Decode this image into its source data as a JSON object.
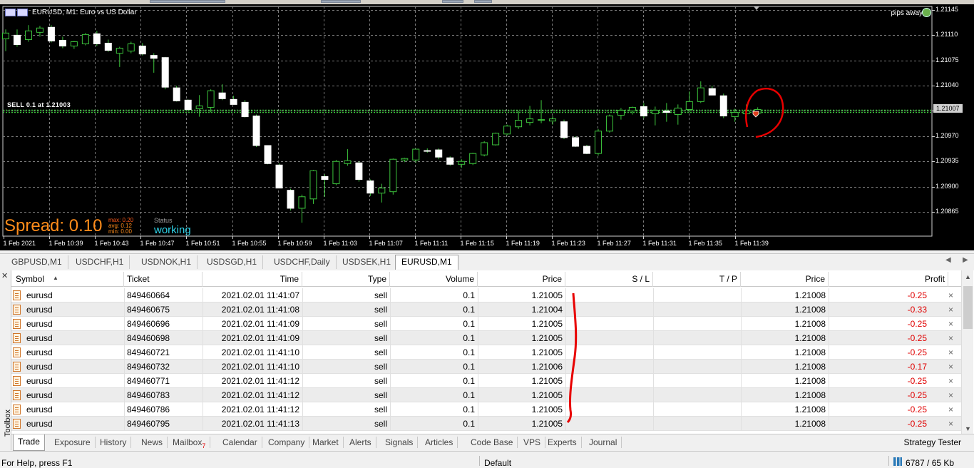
{
  "chart": {
    "title": "EURUSD, M1:  Euro vs US Dollar",
    "pips_away": "pips away",
    "sell_label": "SELL 0.1 at 1.21003",
    "current_price": "1.21007",
    "spread_label": "Spread: 0.10",
    "spread_max": "max: 0.20",
    "spread_avg": "avg: 0.12",
    "spread_min": "min: 0.00",
    "status_label": "Status",
    "status_value": "working",
    "y_axis": [
      "1.21145",
      "1.21110",
      "1.21075",
      "1.21040",
      "1.20970",
      "1.20935",
      "1.20900",
      "1.20865"
    ],
    "x_axis": [
      "1 Feb 2021",
      "1 Feb 10:39",
      "1 Feb 10:43",
      "1 Feb 10:47",
      "1 Feb 10:51",
      "1 Feb 10:55",
      "1 Feb 10:59",
      "1 Feb 11:03",
      "1 Feb 11:07",
      "1 Feb 11:11",
      "1 Feb 11:15",
      "1 Feb 11:19",
      "1 Feb 11:23",
      "1 Feb 11:27",
      "1 Feb 11:31",
      "1 Feb 11:35",
      "1 Feb 11:39"
    ],
    "colors": {
      "background": "#000000",
      "grid": "#7a7a7a",
      "bull": "#000000",
      "bull_wick": "#3cc43c",
      "bear": "#ffffff",
      "ask_line": "#3cc43c",
      "spread_text": "#ff8c1a",
      "status_text": "#2fd3e8"
    },
    "candles": [
      {
        "o": 1.21105,
        "h": 1.21118,
        "l": 1.21088,
        "c": 1.21113
      },
      {
        "o": 1.2111,
        "h": 1.21118,
        "l": 1.21094,
        "c": 1.21097
      },
      {
        "o": 1.21104,
        "h": 1.21124,
        "l": 1.21101,
        "c": 1.21116
      },
      {
        "o": 1.21114,
        "h": 1.21123,
        "l": 1.21108,
        "c": 1.2112
      },
      {
        "o": 1.21121,
        "h": 1.21124,
        "l": 1.211,
        "c": 1.21102
      },
      {
        "o": 1.21103,
        "h": 1.21108,
        "l": 1.21092,
        "c": 1.21095
      },
      {
        "o": 1.21095,
        "h": 1.21102,
        "l": 1.21091,
        "c": 1.21101
      },
      {
        "o": 1.21098,
        "h": 1.21113,
        "l": 1.21096,
        "c": 1.21111
      },
      {
        "o": 1.21112,
        "h": 1.21116,
        "l": 1.21095,
        "c": 1.21098
      },
      {
        "o": 1.21099,
        "h": 1.21104,
        "l": 1.21087,
        "c": 1.21089
      },
      {
        "o": 1.21085,
        "h": 1.21094,
        "l": 1.21066,
        "c": 1.21092
      },
      {
        "o": 1.21088,
        "h": 1.21101,
        "l": 1.21085,
        "c": 1.21098
      },
      {
        "o": 1.21095,
        "h": 1.21099,
        "l": 1.21082,
        "c": 1.21084
      },
      {
        "o": 1.21082,
        "h": 1.21085,
        "l": 1.21058,
        "c": 1.21078
      },
      {
        "o": 1.21079,
        "h": 1.2108,
        "l": 1.21035,
        "c": 1.21038
      },
      {
        "o": 1.21037,
        "h": 1.2104,
        "l": 1.21018,
        "c": 1.21019
      },
      {
        "o": 1.2102,
        "h": 1.21021,
        "l": 1.21006,
        "c": 1.21007
      },
      {
        "o": 1.21008,
        "h": 1.21027,
        "l": 1.20997,
        "c": 1.21012
      },
      {
        "o": 1.2101,
        "h": 1.21035,
        "l": 1.21003,
        "c": 1.21033
      },
      {
        "o": 1.2103,
        "h": 1.21042,
        "l": 1.2102,
        "c": 1.21022
      },
      {
        "o": 1.21021,
        "h": 1.21026,
        "l": 1.21014,
        "c": 1.21014
      },
      {
        "o": 1.21017,
        "h": 1.2102,
        "l": 1.20996,
        "c": 1.20997
      },
      {
        "o": 1.20998,
        "h": 1.21,
        "l": 1.20955,
        "c": 1.20957
      },
      {
        "o": 1.20957,
        "h": 1.20957,
        "l": 1.20931,
        "c": 1.20932
      },
      {
        "o": 1.2093,
        "h": 1.20932,
        "l": 1.20898,
        "c": 1.20898
      },
      {
        "o": 1.20895,
        "h": 1.20897,
        "l": 1.20867,
        "c": 1.2087
      },
      {
        "o": 1.2087,
        "h": 1.20889,
        "l": 1.2085,
        "c": 1.20886
      },
      {
        "o": 1.20883,
        "h": 1.20923,
        "l": 1.20876,
        "c": 1.20922
      },
      {
        "o": 1.20914,
        "h": 1.20917,
        "l": 1.20886,
        "c": 1.2091
      },
      {
        "o": 1.20904,
        "h": 1.20937,
        "l": 1.20902,
        "c": 1.20935
      },
      {
        "o": 1.20932,
        "h": 1.20952,
        "l": 1.20929,
        "c": 1.20936
      },
      {
        "o": 1.20933,
        "h": 1.20935,
        "l": 1.20907,
        "c": 1.2091
      },
      {
        "o": 1.20908,
        "h": 1.2091,
        "l": 1.20887,
        "c": 1.20891
      },
      {
        "o": 1.20891,
        "h": 1.20904,
        "l": 1.20878,
        "c": 1.20898
      },
      {
        "o": 1.20893,
        "h": 1.20939,
        "l": 1.20889,
        "c": 1.20938
      },
      {
        "o": 1.20937,
        "h": 1.2094,
        "l": 1.20934,
        "c": 1.20939
      },
      {
        "o": 1.20937,
        "h": 1.20952,
        "l": 1.20933,
        "c": 1.20952
      },
      {
        "o": 1.2095,
        "h": 1.20953,
        "l": 1.20947,
        "c": 1.20949
      },
      {
        "o": 1.20951,
        "h": 1.20953,
        "l": 1.20938,
        "c": 1.20941
      },
      {
        "o": 1.2094,
        "h": 1.20942,
        "l": 1.20929,
        "c": 1.20931
      },
      {
        "o": 1.20931,
        "h": 1.20938,
        "l": 1.20926,
        "c": 1.20935
      },
      {
        "o": 1.20932,
        "h": 1.20947,
        "l": 1.2093,
        "c": 1.20946
      },
      {
        "o": 1.20944,
        "h": 1.20963,
        "l": 1.20942,
        "c": 1.20961
      },
      {
        "o": 1.20958,
        "h": 1.20975,
        "l": 1.20957,
        "c": 1.20974
      },
      {
        "o": 1.20973,
        "h": 1.20986,
        "l": 1.20971,
        "c": 1.20984
      },
      {
        "o": 1.20983,
        "h": 1.21005,
        "l": 1.2098,
        "c": 1.20992
      },
      {
        "o": 1.20989,
        "h": 1.21012,
        "l": 1.20985,
        "c": 1.20994
      },
      {
        "o": 1.20993,
        "h": 1.2102,
        "l": 1.20988,
        "c": 1.20993
      },
      {
        "o": 1.20991,
        "h": 1.20998,
        "l": 1.20986,
        "c": 1.20994
      },
      {
        "o": 1.2099,
        "h": 1.20993,
        "l": 1.20966,
        "c": 1.20968
      },
      {
        "o": 1.20968,
        "h": 1.2097,
        "l": 1.20955,
        "c": 1.20956
      },
      {
        "o": 1.20956,
        "h": 1.20958,
        "l": 1.20945,
        "c": 1.20946
      },
      {
        "o": 1.20946,
        "h": 1.2098,
        "l": 1.20943,
        "c": 1.20977
      },
      {
        "o": 1.20977,
        "h": 1.21,
        "l": 1.20975,
        "c": 1.20998
      },
      {
        "o": 1.20999,
        "h": 1.21009,
        "l": 1.20993,
        "c": 1.21006
      },
      {
        "o": 1.21005,
        "h": 1.21011,
        "l": 1.21,
        "c": 1.2101
      },
      {
        "o": 1.21011,
        "h": 1.21016,
        "l": 1.20995,
        "c": 1.20998
      },
      {
        "o": 1.21001,
        "h": 1.21011,
        "l": 1.20985,
        "c": 1.21006
      },
      {
        "o": 1.21005,
        "h": 1.21016,
        "l": 1.2099,
        "c": 1.21003
      },
      {
        "o": 1.21,
        "h": 1.21014,
        "l": 1.20986,
        "c": 1.21009
      },
      {
        "o": 1.21007,
        "h": 1.21032,
        "l": 1.21003,
        "c": 1.21018
      },
      {
        "o": 1.21018,
        "h": 1.21046,
        "l": 1.21016,
        "c": 1.21037
      },
      {
        "o": 1.21036,
        "h": 1.2104,
        "l": 1.21027,
        "c": 1.21027
      },
      {
        "o": 1.21026,
        "h": 1.21029,
        "l": 1.20995,
        "c": 1.20998
      },
      {
        "o": 1.20997,
        "h": 1.21008,
        "l": 1.2099,
        "c": 1.21003
      },
      {
        "o": 1.21001,
        "h": 1.21014,
        "l": 1.20997,
        "c": 1.21005
      },
      {
        "o": 1.21002,
        "h": 1.2101,
        "l": 1.20998,
        "c": 1.21007
      }
    ]
  },
  "chart_tabs": [
    "GBPUSD,M1",
    "USDCHF,H1",
    "USDNOK,H1",
    "USDSGD,H1",
    "USDCHF,Daily",
    "USDSEK,H1",
    "EURUSD,M1"
  ],
  "toolbox_label": "Toolbox",
  "table": {
    "columns": [
      "Symbol",
      "Ticket",
      "Time",
      "Type",
      "Volume",
      "Price",
      "S / L",
      "T / P",
      "Price",
      "Profit"
    ],
    "rows": [
      {
        "symbol": "eurusd",
        "ticket": "849460664",
        "time": "2021.02.01 11:41:07",
        "type": "sell",
        "volume": "0.1",
        "price": "1.21005",
        "sl": "",
        "tp": "",
        "cur": "1.21008",
        "profit": "-0.25"
      },
      {
        "symbol": "eurusd",
        "ticket": "849460675",
        "time": "2021.02.01 11:41:08",
        "type": "sell",
        "volume": "0.1",
        "price": "1.21004",
        "sl": "",
        "tp": "",
        "cur": "1.21008",
        "profit": "-0.33"
      },
      {
        "symbol": "eurusd",
        "ticket": "849460696",
        "time": "2021.02.01 11:41:09",
        "type": "sell",
        "volume": "0.1",
        "price": "1.21005",
        "sl": "",
        "tp": "",
        "cur": "1.21008",
        "profit": "-0.25"
      },
      {
        "symbol": "eurusd",
        "ticket": "849460698",
        "time": "2021.02.01 11:41:09",
        "type": "sell",
        "volume": "0.1",
        "price": "1.21005",
        "sl": "",
        "tp": "",
        "cur": "1.21008",
        "profit": "-0.25"
      },
      {
        "symbol": "eurusd",
        "ticket": "849460721",
        "time": "2021.02.01 11:41:10",
        "type": "sell",
        "volume": "0.1",
        "price": "1.21005",
        "sl": "",
        "tp": "",
        "cur": "1.21008",
        "profit": "-0.25"
      },
      {
        "symbol": "eurusd",
        "ticket": "849460732",
        "time": "2021.02.01 11:41:10",
        "type": "sell",
        "volume": "0.1",
        "price": "1.21006",
        "sl": "",
        "tp": "",
        "cur": "1.21008",
        "profit": "-0.17"
      },
      {
        "symbol": "eurusd",
        "ticket": "849460771",
        "time": "2021.02.01 11:41:12",
        "type": "sell",
        "volume": "0.1",
        "price": "1.21005",
        "sl": "",
        "tp": "",
        "cur": "1.21008",
        "profit": "-0.25"
      },
      {
        "symbol": "eurusd",
        "ticket": "849460783",
        "time": "2021.02.01 11:41:12",
        "type": "sell",
        "volume": "0.1",
        "price": "1.21005",
        "sl": "",
        "tp": "",
        "cur": "1.21008",
        "profit": "-0.25"
      },
      {
        "symbol": "eurusd",
        "ticket": "849460786",
        "time": "2021.02.01 11:41:12",
        "type": "sell",
        "volume": "0.1",
        "price": "1.21005",
        "sl": "",
        "tp": "",
        "cur": "1.21008",
        "profit": "-0.25"
      },
      {
        "symbol": "eurusd",
        "ticket": "849460795",
        "time": "2021.02.01 11:41:13",
        "type": "sell",
        "volume": "0.1",
        "price": "1.21005",
        "sl": "",
        "tp": "",
        "cur": "1.21008",
        "profit": "-0.25"
      }
    ],
    "close_glyph": "×"
  },
  "bottom_tabs": [
    "Trade",
    "Exposure",
    "History",
    "News",
    "Mailbox",
    "Calendar",
    "Company",
    "Market",
    "Alerts",
    "Signals",
    "Articles",
    "Code Base",
    "VPS",
    "Experts",
    "Journal"
  ],
  "mailbox_count": "7",
  "strategy_tester": "Strategy Tester",
  "status_bar": {
    "help": "For Help, press F1",
    "profile": "Default",
    "traffic": "6787 / 65 Kb"
  }
}
